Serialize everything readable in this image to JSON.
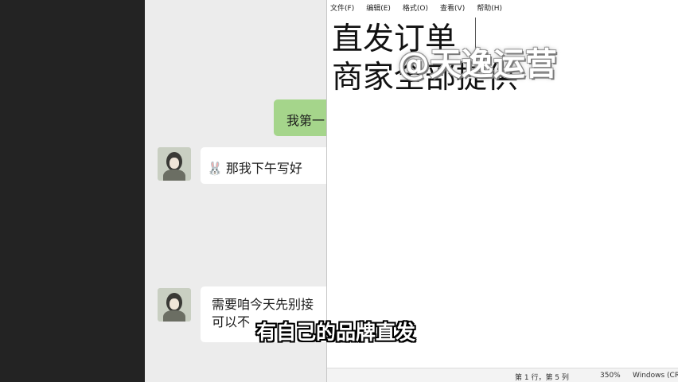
{
  "chat": {
    "self_message": "我第一",
    "messages": [
      {
        "emoji": "🐰",
        "text": "那我下午写好"
      },
      {
        "line1": "需要咱今天先别接",
        "line2": "可以不"
      }
    ]
  },
  "notepad": {
    "menu": [
      "文件(F)",
      "编辑(E)",
      "格式(O)",
      "查看(V)",
      "帮助(H)"
    ],
    "lines": [
      "直发订单",
      "商家全部提供"
    ],
    "status": {
      "position": "第 1 行，第 5 列",
      "zoom": "350%",
      "encoding": "Windows (CR"
    }
  },
  "overlay": {
    "watermark": "@天逸运营",
    "subtitle": "有自己的品牌直发"
  }
}
